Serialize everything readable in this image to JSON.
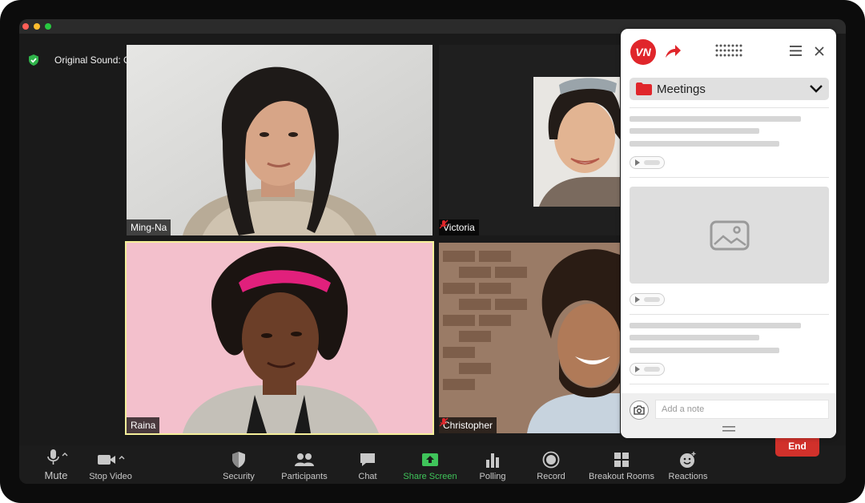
{
  "window": {
    "traffic_lights": [
      "#ff5f57",
      "#febc2e",
      "#28c840"
    ]
  },
  "audio": {
    "original_sound_label": "Original Sound: Off"
  },
  "participants": [
    {
      "name": "Ming-Na",
      "muted": false
    },
    {
      "name": "Victoria",
      "muted": true
    },
    {
      "name": "Raina",
      "muted": false,
      "active_speaker": true
    },
    {
      "name": "Christopher",
      "muted": true
    }
  ],
  "toolbar": {
    "mute": "Mute",
    "stop_video": "Stop Video",
    "security": "Security",
    "participants": "Participants",
    "chat": "Chat",
    "share_screen": "Share Screen",
    "polling": "Polling",
    "record": "Record",
    "breakout_rooms": "Breakout Rooms",
    "reactions": "Reactions",
    "end": "End"
  },
  "panel": {
    "logo_text": "VN",
    "folder_label": "Meetings",
    "note_placeholder": "Add a note"
  },
  "colors": {
    "accent_red": "#e0262b",
    "share_green": "#3fc45a",
    "end_red": "#d1312b",
    "speaker_border": "#f5ef9a"
  }
}
